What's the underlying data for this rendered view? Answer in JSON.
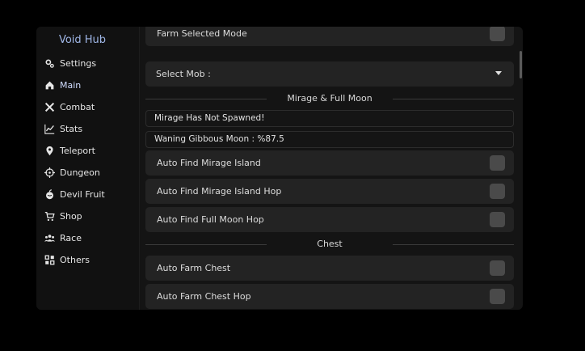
{
  "app": {
    "title": "Void Hub",
    "accent": "#9fb6e6"
  },
  "sidebar": {
    "items": [
      {
        "label": "Settings",
        "icon": "gears-icon"
      },
      {
        "label": "Main",
        "icon": "home-icon",
        "active": true
      },
      {
        "label": "Combat",
        "icon": "crossed-swords-icon"
      },
      {
        "label": "Stats",
        "icon": "chart-line-icon"
      },
      {
        "label": "Teleport",
        "icon": "map-pin-icon"
      },
      {
        "label": "Dungeon",
        "icon": "crosshair-icon"
      },
      {
        "label": "Devil Fruit",
        "icon": "fruit-icon"
      },
      {
        "label": "Shop",
        "icon": "cart-icon"
      },
      {
        "label": "Race",
        "icon": "users-icon"
      },
      {
        "label": "Others",
        "icon": "grid-icon"
      }
    ]
  },
  "main": {
    "farm_selected_mode": "Farm Selected Mode",
    "select_mob": "Select Mob :",
    "mirage_section": "Mirage & Full Moon",
    "mirage_status": "Mirage Has Not Spawned!",
    "moon_status": "Waning Gibbous Moon : %87.5",
    "auto_find_mirage": "Auto Find Mirage Island",
    "auto_find_mirage_hop": "Auto Find Mirage Island Hop",
    "auto_find_full_moon_hop": "Auto Find Full Moon Hop",
    "chest_section": "Chest",
    "auto_farm_chest": "Auto Farm Chest",
    "auto_farm_chest_hop": "Auto Farm Chest Hop"
  }
}
